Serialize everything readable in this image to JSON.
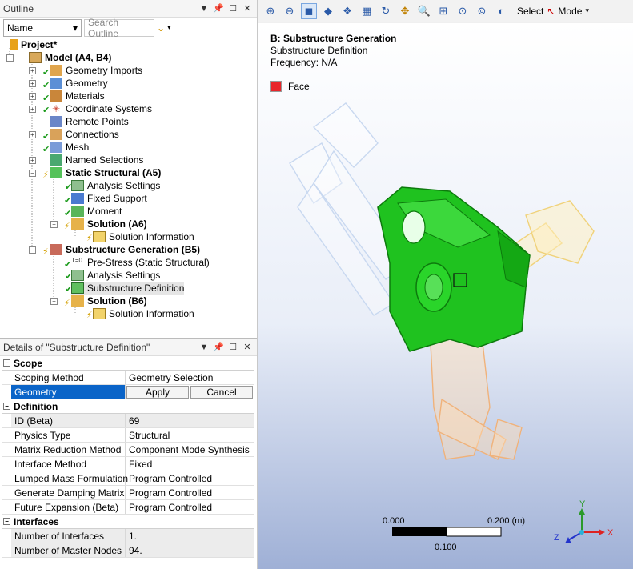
{
  "outline": {
    "title": "Outline",
    "name_select": "Name",
    "search_placeholder": "Search Outline"
  },
  "tree": [
    {
      "label": "Project*",
      "bold": true
    },
    {
      "label": "Model (A4, B4)",
      "bold": true
    },
    {
      "label": "Geometry Imports"
    },
    {
      "label": "Geometry"
    },
    {
      "label": "Materials"
    },
    {
      "label": "Coordinate Systems"
    },
    {
      "label": "Remote Points"
    },
    {
      "label": "Connections"
    },
    {
      "label": "Mesh"
    },
    {
      "label": "Named Selections"
    },
    {
      "label": "Static Structural (A5)",
      "bold": true
    },
    {
      "label": "Analysis Settings"
    },
    {
      "label": "Fixed Support"
    },
    {
      "label": "Moment"
    },
    {
      "label": "Solution (A6)",
      "bold": true
    },
    {
      "label": "Solution Information"
    },
    {
      "label": "Substructure Generation (B5)",
      "bold": true
    },
    {
      "label": "Pre-Stress (Static Structural)"
    },
    {
      "label": "Analysis Settings"
    },
    {
      "label": "Substructure Definition"
    },
    {
      "label": "Solution (B6)",
      "bold": true
    },
    {
      "label": "Solution Information"
    }
  ],
  "details": {
    "title": "Details of \"Substructure Definition\"",
    "groups": {
      "scope": "Scope",
      "definition": "Definition",
      "interfaces": "Interfaces"
    },
    "scope_rows": [
      {
        "k": "Scoping Method",
        "v": "Geometry Selection"
      },
      {
        "k": "Geometry",
        "apply": "Apply",
        "cancel": "Cancel"
      }
    ],
    "definition_rows": [
      {
        "k": "ID (Beta)",
        "v": "69"
      },
      {
        "k": "Physics Type",
        "v": "Structural"
      },
      {
        "k": "Matrix Reduction Method",
        "v": "Component Mode Synthesis"
      },
      {
        "k": "Interface Method",
        "v": "Fixed"
      },
      {
        "k": "Lumped Mass Formulation",
        "v": "Program Controlled"
      },
      {
        "k": "Generate Damping Matrix",
        "v": "Program Controlled"
      },
      {
        "k": "Future Expansion (Beta)",
        "v": "Program Controlled"
      }
    ],
    "interface_rows": [
      {
        "k": "Number of Interfaces",
        "v": "1."
      },
      {
        "k": "Number of Master Nodes",
        "v": "94."
      }
    ]
  },
  "viewport": {
    "toolbar": {
      "select_label": "Select",
      "mode_label": "Mode"
    },
    "heading": "B: Substructure Generation",
    "subheading": "Substructure Definition",
    "frequency": "Frequency: N/A",
    "legend_label": "Face",
    "scale": {
      "left": "0.000",
      "right": "0.200 (m)",
      "mid": "0.100"
    },
    "axes": {
      "x": "X",
      "y": "Y",
      "z": "Z"
    }
  },
  "colors": {
    "selection_green": "#22cc22",
    "legend_face": "#e8262b",
    "highlight_blue": "#0a64c8"
  }
}
